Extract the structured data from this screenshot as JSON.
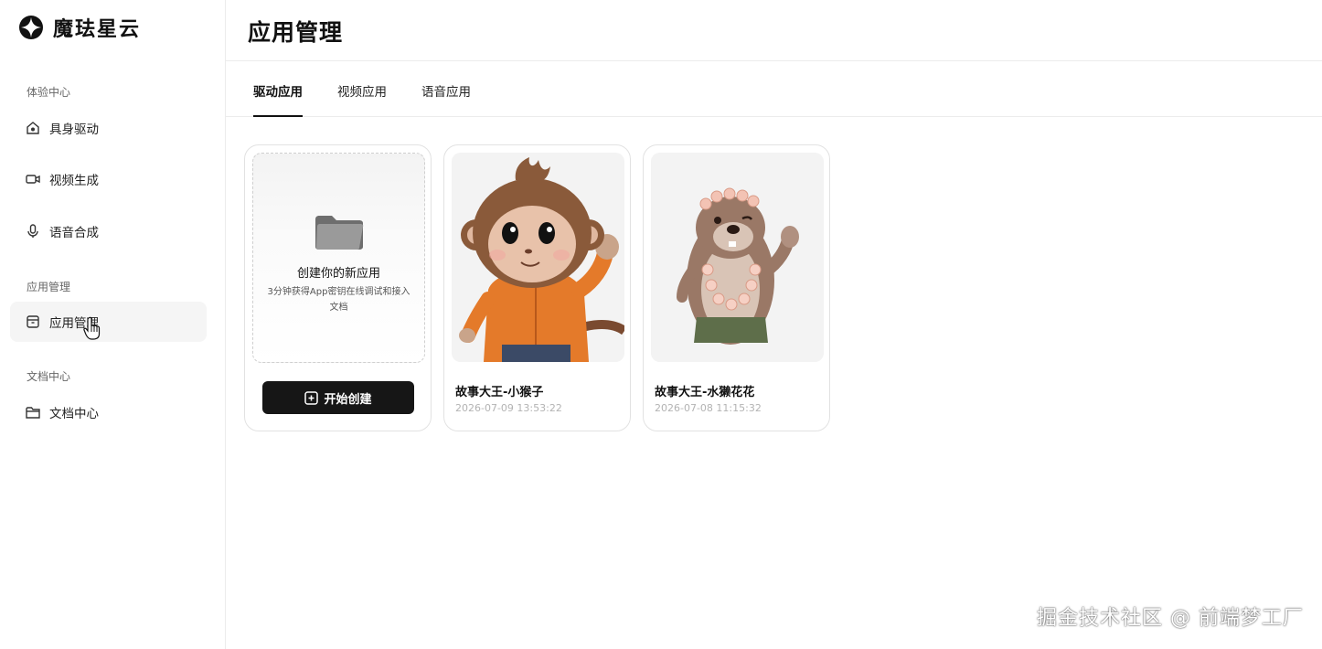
{
  "brand": {
    "name": "魔珐星云",
    "logo_icon": "brand-logo-icon"
  },
  "sidebar": {
    "sections": [
      {
        "label": "体验中心",
        "items": [
          {
            "label": "具身驱动",
            "icon": "home-icon"
          },
          {
            "label": "视频生成",
            "icon": "video-icon"
          },
          {
            "label": "语音合成",
            "icon": "microphone-icon"
          }
        ]
      },
      {
        "label": "应用管理",
        "items": [
          {
            "label": "应用管理",
            "icon": "box-icon",
            "active": true
          }
        ]
      },
      {
        "label": "文档中心",
        "items": [
          {
            "label": "文档中心",
            "icon": "folder-icon"
          }
        ]
      }
    ]
  },
  "header": {
    "title": "应用管理"
  },
  "tabs": [
    {
      "label": "驱动应用",
      "active": true
    },
    {
      "label": "视频应用"
    },
    {
      "label": "语音应用"
    }
  ],
  "create_card": {
    "title": "创建你的新应用",
    "description": "3分钟获得App密钥在线调试和接入文档",
    "button_label": "开始创建"
  },
  "apps": [
    {
      "name": "故事大王-小猴子",
      "created": "2026-07-09 13:53:22",
      "avatar": "monkey"
    },
    {
      "name": "故事大王-水獭花花",
      "created": "2026-07-08 11:15:32",
      "avatar": "otter"
    }
  ],
  "watermark": "掘金技术社区 @ 前端梦工厂",
  "colors": {
    "primary_button": "#161616",
    "active_nav_bg": "#f5f5f5",
    "muted_text": "#b3b3b3"
  }
}
